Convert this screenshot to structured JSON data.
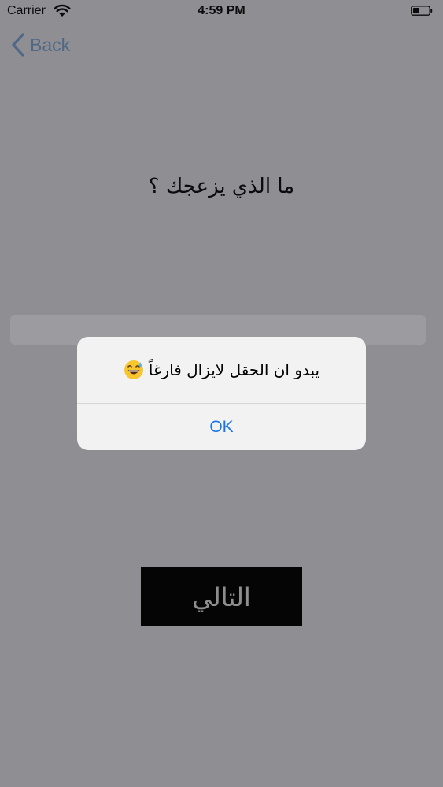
{
  "status_bar": {
    "carrier": "Carrier",
    "time": "4:59 PM"
  },
  "nav": {
    "back_label": "Back"
  },
  "main": {
    "question": "ما الذي يزعجك ؟",
    "answer_value": "",
    "next_label": "التالي"
  },
  "alert": {
    "message": "يبدو ان الحقل لايزال فارغاً",
    "emoji": "grinning-sweat-face-icon",
    "ok_label": "OK"
  },
  "colors": {
    "dimmed_background": "#8f8e93",
    "alert_background": "#f2f2f2",
    "link_blue": "#1a73e8",
    "button_black": "#050505"
  }
}
